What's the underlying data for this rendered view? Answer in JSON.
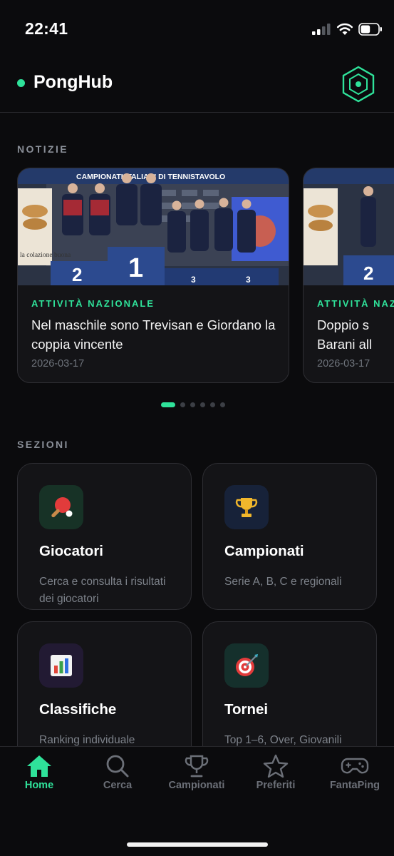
{
  "status_bar": {
    "time": "22:41",
    "battery_level": 0.55
  },
  "header": {
    "title": "PongHub",
    "accent_color": "#2fe29a",
    "logo_icon": "hexagon-target-logo-icon"
  },
  "news": {
    "section_label": "NOTIZIE",
    "cards": [
      {
        "category": "ATTIVITÀ NAZIONALE",
        "title": "Nel maschile sono Trevisan e Giordano la coppia vincente",
        "date": "2026-03-17",
        "photo": "podium-photo",
        "banner_text": "CAMPIONATI ITALIANI DI TENNISTAVOLO",
        "sign_text": "la colazione buona"
      },
      {
        "category": "ATTIVITÀ NAZIONALE",
        "title": "Doppio s… Barani all…",
        "title_line1": "Doppio s",
        "title_line2": "Barani all",
        "date": "2026-03-17",
        "photo": "podium-photo"
      }
    ],
    "page_count": 6,
    "active_page": 1
  },
  "sections": {
    "section_label": "SEZIONI",
    "tiles": [
      {
        "title": "Giocatori",
        "description": "Cerca e consulta i risultati dei giocatori",
        "icon": "ping-pong-paddle-icon",
        "icon_bg": "#173226"
      },
      {
        "title": "Campionati",
        "description": "Serie A, B, C e regionali",
        "icon": "trophy-icon",
        "icon_bg": "#172239"
      },
      {
        "title": "Classifiche",
        "description": "Ranking individuale",
        "icon": "bar-chart-icon",
        "icon_bg": "#221a33"
      },
      {
        "title": "Tornei",
        "description": "Top 1–6, Over, Giovanili",
        "icon": "dart-target-icon",
        "icon_bg": "#15302c"
      }
    ]
  },
  "tab_bar": {
    "tabs": [
      {
        "label": "Home",
        "icon": "home-icon",
        "active": true
      },
      {
        "label": "Cerca",
        "icon": "search-icon",
        "active": false
      },
      {
        "label": "Campionati",
        "icon": "trophy-outline-icon",
        "active": false
      },
      {
        "label": "Preferiti",
        "icon": "star-icon",
        "active": false
      },
      {
        "label": "FantaPing",
        "icon": "gamepad-icon",
        "active": false
      }
    ]
  }
}
